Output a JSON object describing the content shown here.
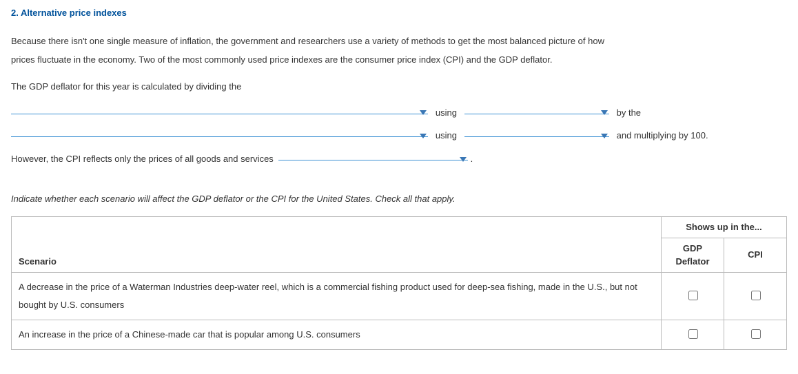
{
  "heading": "2. Alternative price indexes",
  "intro": {
    "line1": "Because there isn't one single measure of inflation, the government and researchers use a variety of methods to get the most balanced picture of how",
    "line2": "prices fluctuate in the economy. Two of the most commonly used price indexes are the consumer price index (CPI) and the GDP deflator."
  },
  "fillin": {
    "lead": "The GDP deflator for this year is calculated by dividing the",
    "using1": "using",
    "bythe": "by the",
    "using2": "using",
    "mult": "and multiplying by 100.",
    "however": "However, the CPI reflects only the prices of all goods and services",
    "period": "."
  },
  "instruction": "Indicate whether each scenario will affect the GDP deflator or the CPI for the United States. Check all that apply.",
  "table": {
    "groupHeader": "Shows up in the...",
    "scenarioHeader": "Scenario",
    "col1": "GDP Deflator",
    "col2": "CPI",
    "rows": [
      {
        "text": "A decrease in the price of a Waterman Industries deep-water reel, which is a commercial fishing product used for deep-sea fishing, made in the U.S., but not bought by U.S. consumers"
      },
      {
        "text": "An increase in the price of a Chinese-made car that is popular among U.S. consumers"
      }
    ]
  }
}
